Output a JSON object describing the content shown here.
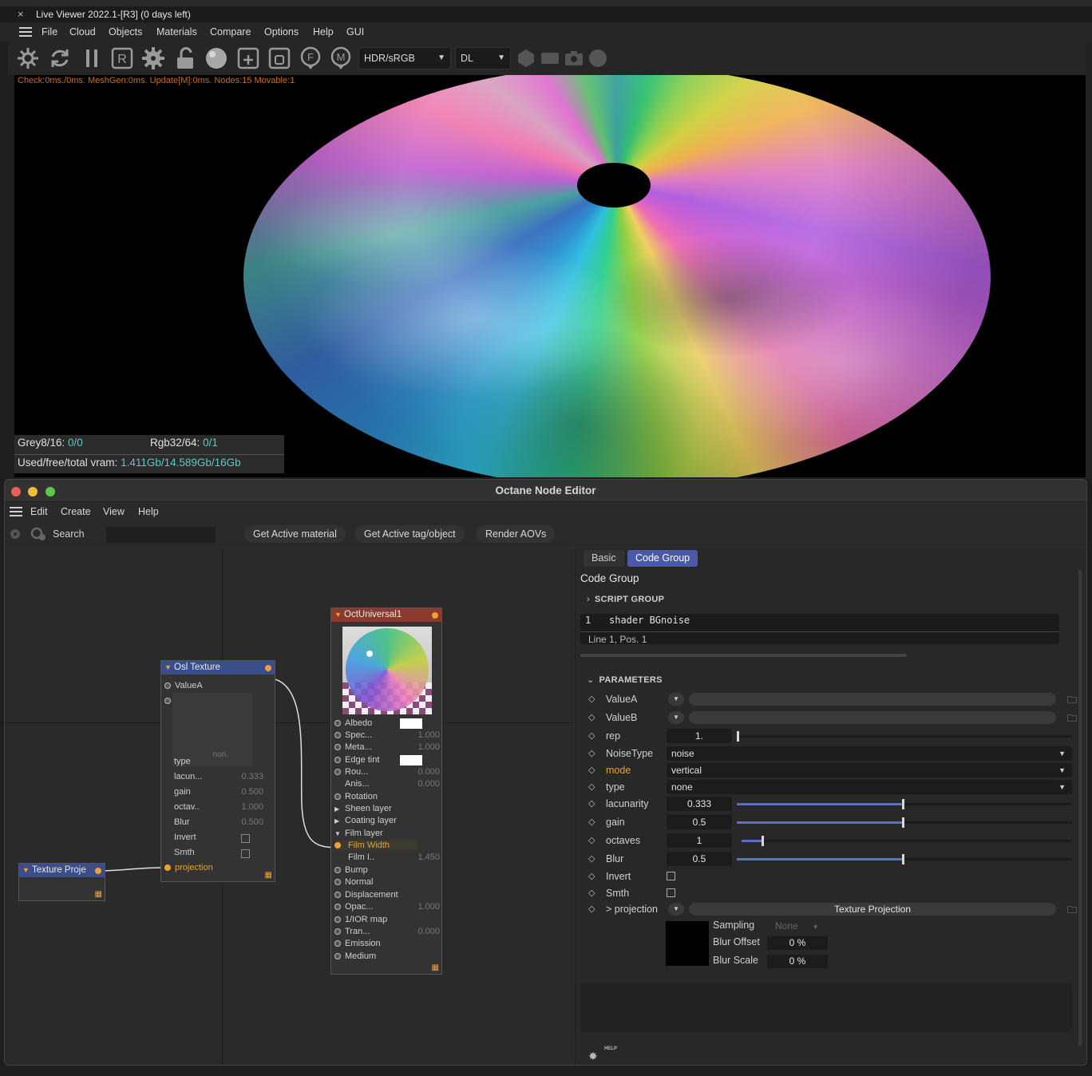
{
  "live_viewer": {
    "close_glyph": "×",
    "title": "Live Viewer 2022.1-[R3] (0 days left)",
    "menu": [
      "File",
      "Cloud",
      "Objects",
      "Materials",
      "Compare",
      "Options",
      "Help",
      "GUI"
    ],
    "toolbar_icons": [
      "settings-gear-icon",
      "refresh-icon",
      "pause-icon",
      "region-r-icon",
      "gear-icon",
      "lock-open-icon",
      "material-ball-icon",
      "add-square-icon",
      "object-square-icon",
      "focus-f-icon",
      "material-m-icon"
    ],
    "toolbar_right_icons": [
      "cube-icon",
      "film-icon",
      "camera-icon",
      "sphere-icon"
    ],
    "colorspace": "HDR/sRGB",
    "kernel": "DL",
    "status": "Check:0ms./0ms. MeshGen:0ms. Update[M]:0ms. Nodes:15 Movable:1",
    "stats": {
      "grey_label": "Grey8/16:",
      "grey_value": "0/0",
      "rgb_label": "Rgb32/64:",
      "rgb_value": "0/1",
      "vram_label": "Used/free/total vram:",
      "vram_value": "1.411Gb/14.589Gb/16Gb"
    }
  },
  "node_editor": {
    "title": "Octane Node Editor",
    "menu": [
      "Edit",
      "Create",
      "View",
      "Help"
    ],
    "search_label": "Search",
    "search_value": "",
    "buttons": [
      "Get Active material",
      "Get Active tag/object",
      "Render AOVs"
    ],
    "nodes": {
      "osl": {
        "title": "Osl Texture",
        "valueA": "ValueA",
        "preview_label": "non.",
        "rows": [
          {
            "name": "type",
            "value": ""
          },
          {
            "name": "lacun...",
            "value": "0.333"
          },
          {
            "name": "gain",
            "value": "0.500"
          },
          {
            "name": "octav..",
            "value": "1.000"
          },
          {
            "name": "Blur",
            "value": "0.500"
          },
          {
            "name": "Invert",
            "value": ""
          },
          {
            "name": "Smth",
            "value": ""
          },
          {
            "name": "projection",
            "value": ""
          }
        ]
      },
      "universal": {
        "title": "OctUniversal1",
        "rows": [
          {
            "name": "Albedo",
            "value": ""
          },
          {
            "name": "Spec...",
            "value": "1.000"
          },
          {
            "name": "Meta...",
            "value": "1.000"
          },
          {
            "name": "Edge tint",
            "value": ""
          },
          {
            "name": "Rou...",
            "value": "0.000"
          },
          {
            "name": "Anis...",
            "value": "0.000"
          },
          {
            "name": "Rotation",
            "value": ""
          },
          {
            "name": "Sheen layer",
            "value": ""
          },
          {
            "name": "Coating layer",
            "value": ""
          },
          {
            "name": "Film layer",
            "value": ""
          },
          {
            "name": "Film Width",
            "value": ""
          },
          {
            "name": "Film I..",
            "value": "1.450"
          },
          {
            "name": "Bump",
            "value": ""
          },
          {
            "name": "Normal",
            "value": ""
          },
          {
            "name": "Displacement",
            "value": ""
          },
          {
            "name": "Opac...",
            "value": "1.000"
          },
          {
            "name": "1/IOR map",
            "value": ""
          },
          {
            "name": "Tran...",
            "value": "0.000"
          },
          {
            "name": "Emission",
            "value": ""
          },
          {
            "name": "Medium",
            "value": ""
          }
        ]
      },
      "texproj": {
        "title": "Texture Proje"
      }
    },
    "panel": {
      "tabs": [
        "Basic",
        "Code Group"
      ],
      "heading": "Code Group",
      "script_group": "SCRIPT GROUP",
      "code_line_no": "1",
      "code_text": "shader BGnoise",
      "code_footer": "Line 1, Pos. 1",
      "parameters_label": "PARAMETERS",
      "params": {
        "valueA": "ValueA",
        "valueB": "ValueB",
        "rep_name": "rep",
        "rep_value": "1.",
        "noisetype_name": "NoiseType",
        "noisetype_value": "noise",
        "mode_name": "mode",
        "mode_value": "vertical",
        "type_name": "type",
        "type_value": "none",
        "lac_name": "lacunarity",
        "lac_value": "0.333",
        "gain_name": "gain",
        "gain_value": "0.5",
        "oct_name": "octaves",
        "oct_value": "1",
        "blur_name": "Blur",
        "blur_value": "0.5",
        "invert_name": "Invert",
        "smth_name": "Smth",
        "proj_name": "> projection",
        "proj_value": "Texture Projection"
      },
      "projection_sub": {
        "sampling_label": "Sampling",
        "sampling_value": "None",
        "blur_offset_label": "Blur Offset",
        "blur_offset_value": "0 %",
        "blur_scale_label": "Blur Scale",
        "blur_scale_value": "0 %"
      },
      "help_label": "HELP"
    }
  }
}
